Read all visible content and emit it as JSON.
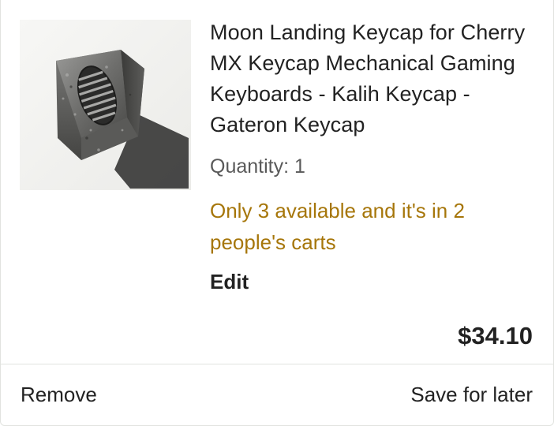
{
  "item": {
    "image_alt": "moon-landing-keycap-photo",
    "title": "Moon Landing Keycap for Cherry MX Keycap Mechanical Gaming Keyboards - Kalih Keycap - Gateron Keycap",
    "quantity": "Quantity: 1",
    "availability": "Only 3 available and it's in 2 people's carts",
    "edit_label": "Edit",
    "price": "$34.10"
  },
  "actions": {
    "remove_label": "Remove",
    "save_label": "Save for later"
  },
  "colors": {
    "availability_text": "#a6760a",
    "divider": "#e1e3df"
  }
}
